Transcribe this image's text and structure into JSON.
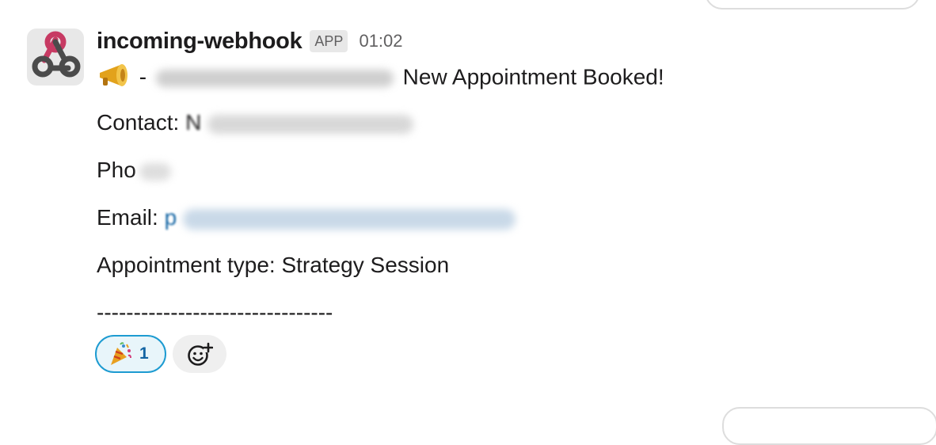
{
  "message": {
    "sender": "incoming-webhook",
    "badge": "APP",
    "time": "01:02",
    "line1_dash": "-",
    "line1_text": "New Appointment Booked!",
    "contact_label": "Contact: ",
    "contact_visible": "N",
    "phone_label": "Pho",
    "email_label": "Email: ",
    "email_visible": "p",
    "appointment": "Appointment type: Strategy Session",
    "separator": "--------------------------------"
  },
  "reactions": [
    {
      "emoji": "tada",
      "count": "1",
      "active": true
    }
  ],
  "icons": {
    "avatar": "webhook-icon",
    "megaphone": "megaphone-icon",
    "add_reaction": "add-reaction-icon"
  },
  "colors": {
    "link": "#1264a3",
    "reaction_border": "#1d9bd1",
    "reaction_bg": "#e8f5fa",
    "webhook_pink": "#c73a63"
  }
}
